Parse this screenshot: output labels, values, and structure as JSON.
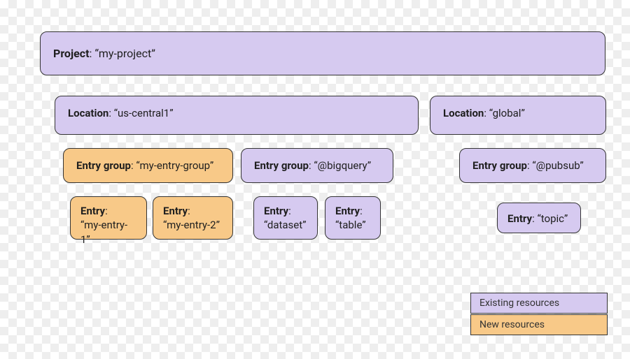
{
  "project": {
    "label": "Project",
    "value": "“my-project”"
  },
  "locations": [
    {
      "label": "Location",
      "value": "“us-central1”"
    },
    {
      "label": "Location",
      "value": "“global”"
    }
  ],
  "entry_groups": [
    {
      "label": "Entry group",
      "value": "“my-entry-group”"
    },
    {
      "label": "Entry group",
      "value": "“@bigquery”"
    },
    {
      "label": "Entry group",
      "value": "“@pubsub”"
    }
  ],
  "entries": [
    {
      "label": "Entry",
      "value": "“my-entry-1”"
    },
    {
      "label": "Entry",
      "value": "“my-entry-2”"
    },
    {
      "label": "Entry",
      "value": "“dataset”"
    },
    {
      "label": "Entry",
      "value": "“table”"
    },
    {
      "label": "Entry",
      "value": "“topic”"
    }
  ],
  "legend": {
    "existing": "Existing resources",
    "new": "New resources"
  }
}
